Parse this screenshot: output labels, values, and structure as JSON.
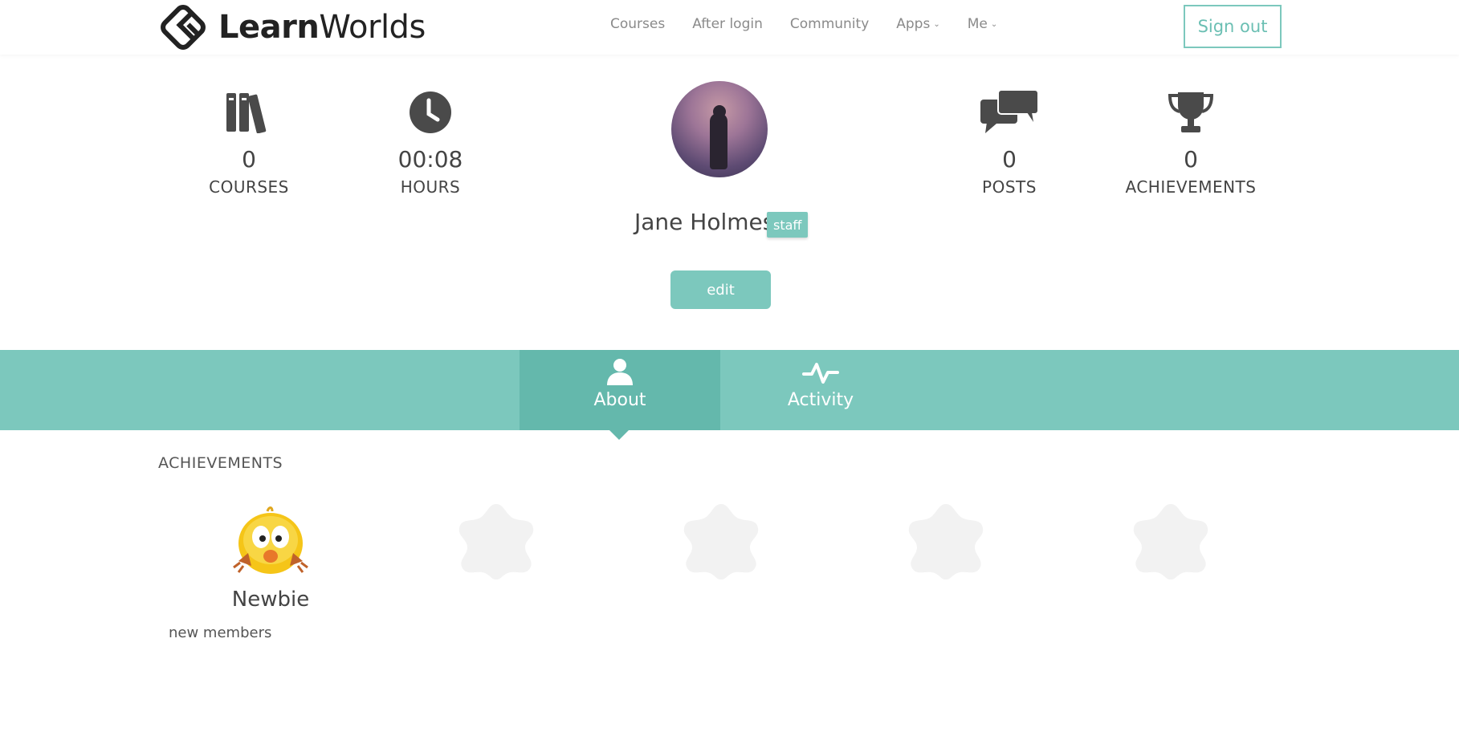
{
  "header": {
    "logo_bold": "Learn",
    "logo_light": "Worlds",
    "nav": [
      {
        "label": "Courses"
      },
      {
        "label": "After login"
      },
      {
        "label": "Community"
      },
      {
        "label": "Apps",
        "dropdown": true
      },
      {
        "label": "Me",
        "dropdown": true
      }
    ],
    "signout_label": "Sign out"
  },
  "stats": {
    "courses": {
      "value": "0",
      "label": "COURSES",
      "icon": "books-icon"
    },
    "hours": {
      "value": "00:08",
      "label": "HOURS",
      "icon": "clock-icon"
    },
    "posts": {
      "value": "0",
      "label": "POSTS",
      "icon": "chat-bubbles-icon"
    },
    "achievements": {
      "value": "0",
      "label": "ACHIEVEMENTS",
      "icon": "trophy-icon"
    }
  },
  "profile": {
    "name": "Jane Holmes",
    "badge": "staff",
    "edit_label": "edit"
  },
  "tabs": [
    {
      "label": "About",
      "icon": "user-icon",
      "active": true
    },
    {
      "label": "Activity",
      "icon": "activity-pulse-icon",
      "active": false
    }
  ],
  "achievements": {
    "title": "ACHIEVEMENTS",
    "items": [
      {
        "name": "Newbie",
        "description": "new members",
        "icon": "chick-icon",
        "earned": true
      },
      {
        "icon": "locked-badge-icon",
        "earned": false
      },
      {
        "icon": "locked-badge-icon",
        "earned": false
      },
      {
        "icon": "locked-badge-icon",
        "earned": false
      },
      {
        "icon": "locked-badge-icon",
        "earned": false
      }
    ]
  },
  "colors": {
    "accent": "#7cc8bd",
    "accent_dark": "#64b8ac",
    "text": "#444444",
    "icon": "#4a4a4a",
    "locked": "#f2f2f2"
  }
}
